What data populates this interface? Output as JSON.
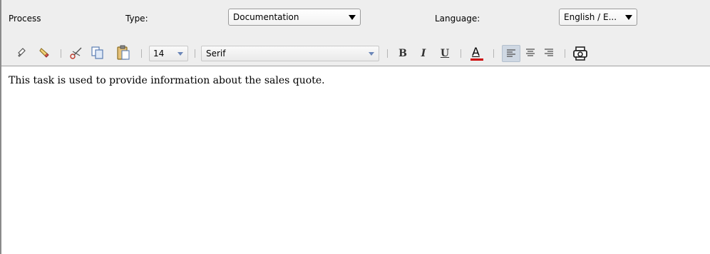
{
  "header": {
    "process_label": "Process",
    "type_label": "Type:",
    "type_value": "Documentation",
    "language_label": "Language:",
    "language_value": "English / E..."
  },
  "toolbar": {
    "font_size": "14",
    "font_family": "Serif",
    "bold_label": "B",
    "italic_label": "I",
    "underline_label": "U",
    "font_color_label": "A",
    "font_color": "#cc0000",
    "active_alignment": "left"
  },
  "editor": {
    "text": "This task is used to provide information about the sales quote."
  }
}
